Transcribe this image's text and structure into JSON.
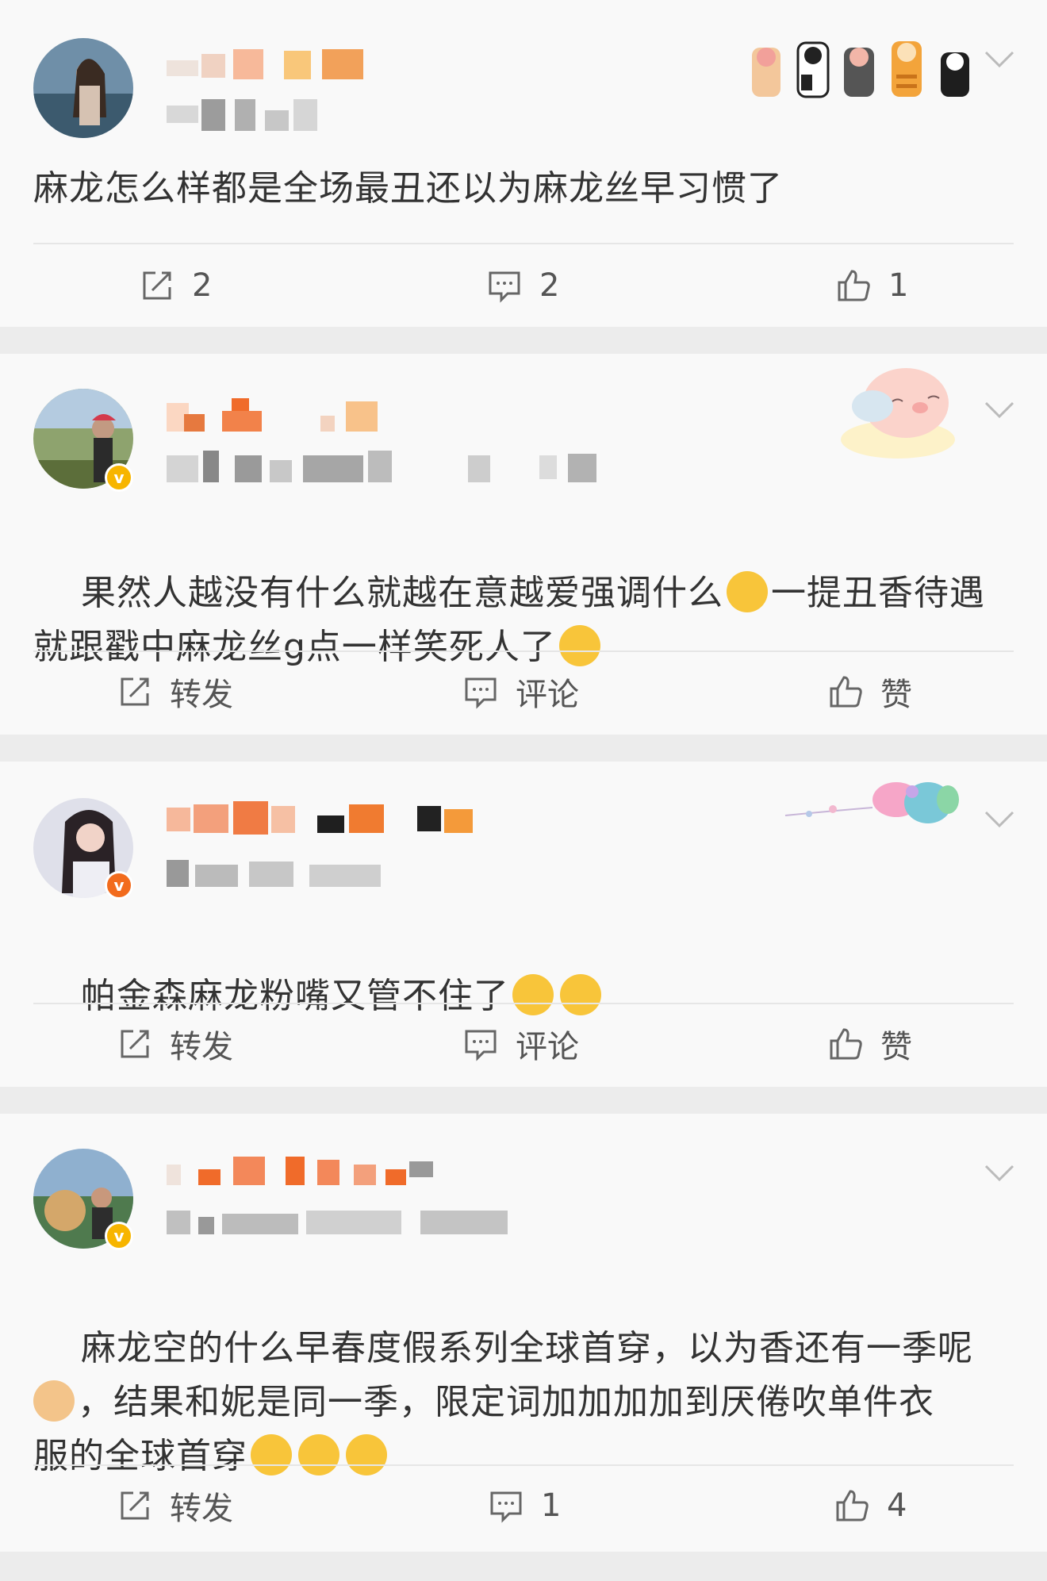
{
  "posts": [
    {
      "text": "麻龙怎么样都是全场最丑还以为麻龙丝早习惯了",
      "repost": "2",
      "comment": "2",
      "like": "1"
    },
    {
      "text": "果然人越没有什么就越在意越爱强调什么😂一提丑香待遇就跟戳中麻龙丝g点一样笑死人了😂",
      "text_line1": "果然人越没有什么就越在意越爱强调什么",
      "text_line1b": "一提丑香待遇",
      "text_line2": "就跟戳中麻龙丝g点一样笑死人了",
      "repost": "转发",
      "comment": "评论",
      "like": "赞"
    },
    {
      "text_line1": "帕金森麻龙粉嘴又管不住了",
      "repost": "转发",
      "comment": "评论",
      "like": "赞"
    },
    {
      "text_line1": "麻龙空的什么早春度假系列全球首穿，以为香还有一季呢",
      "text_line2": "，结果和妮是同一季，限定词加加加加到厌倦吹单件衣",
      "text_line3": "服的全球首穿",
      "repost": "转发",
      "comment": "1",
      "like": "4"
    }
  ],
  "colors": {
    "badge_yellow": "#f7b500",
    "badge_orange": "#f26b1d",
    "text": "#333333",
    "divider": "#e6e6e6"
  },
  "icons": [
    "repost-icon",
    "comment-icon",
    "like-icon",
    "chevron-down-icon",
    "verified-badge-icon",
    "laugh-cry-emoji",
    "sweat-emoji",
    "dog-emoji",
    "crying-emoji"
  ]
}
